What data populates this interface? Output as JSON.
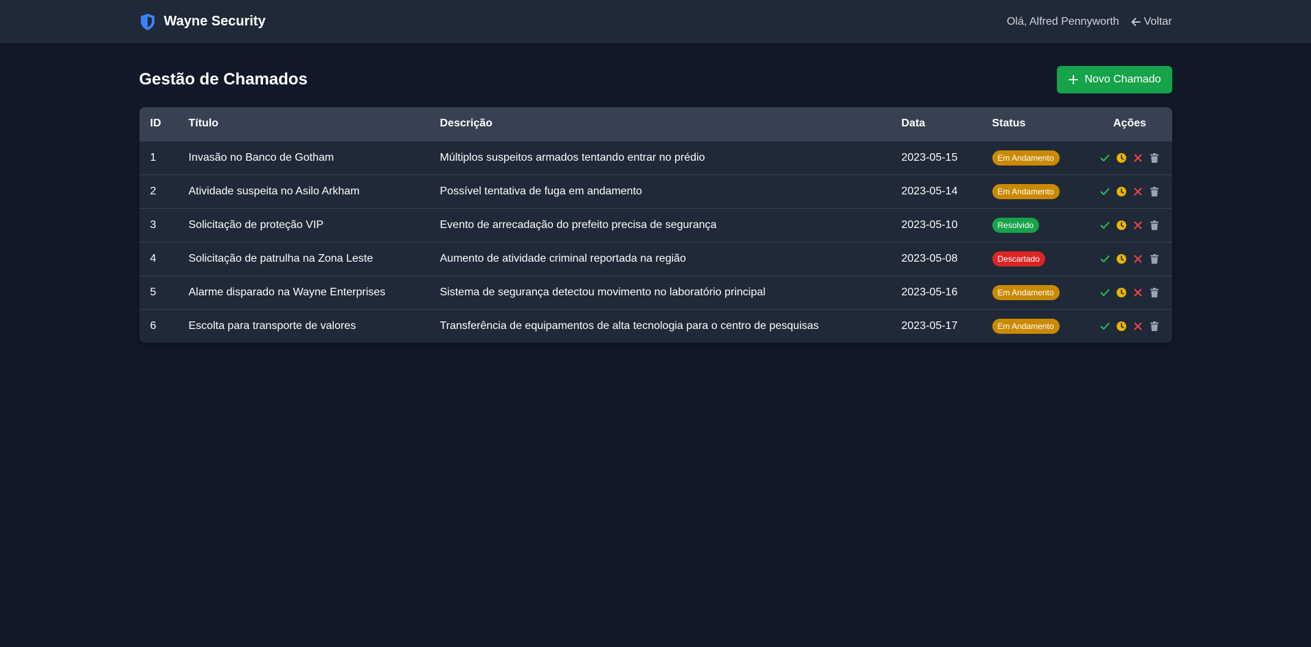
{
  "app": {
    "brand": "Wayne Security",
    "greeting": "Olá, Alfred Pennyworth",
    "back_label": "Voltar"
  },
  "page": {
    "title": "Gestão de Chamados",
    "new_button_label": "Novo Chamado"
  },
  "colors": {
    "background": "#111827",
    "navbar": "#1f2937",
    "table_header": "#374151",
    "brand_icon": "#3b82f6",
    "primary_button": "#16a34a",
    "status_em_andamento": "#ca8a04",
    "status_resolvido": "#16a34a",
    "status_descartado": "#dc2626",
    "action_resolve": "#22c55e",
    "action_pending": "#eab308",
    "action_discard": "#ef4444",
    "action_delete": "#9ca3af"
  },
  "table": {
    "columns": [
      "ID",
      "Título",
      "Descrição",
      "Data",
      "Status",
      "Ações"
    ],
    "rows": [
      {
        "id": "1",
        "title": "Invasão no Banco de Gotham",
        "description": "Múltiplos suspeitos armados tentando entrar no prédio",
        "date": "2023-05-15",
        "status": "Em Andamento",
        "status_color": "#ca8a04"
      },
      {
        "id": "2",
        "title": "Atividade suspeita no Asilo Arkham",
        "description": "Possível tentativa de fuga em andamento",
        "date": "2023-05-14",
        "status": "Em Andamento",
        "status_color": "#ca8a04"
      },
      {
        "id": "3",
        "title": "Solicitação de proteção VIP",
        "description": "Evento de arrecadação do prefeito precisa de segurança",
        "date": "2023-05-10",
        "status": "Resolvido",
        "status_color": "#16a34a"
      },
      {
        "id": "4",
        "title": "Solicitação de patrulha na Zona Leste",
        "description": "Aumento de atividade criminal reportada na região",
        "date": "2023-05-08",
        "status": "Descartado",
        "status_color": "#dc2626"
      },
      {
        "id": "5",
        "title": "Alarme disparado na Wayne Enterprises",
        "description": "Sistema de segurança detectou movimento no laboratório principal",
        "date": "2023-05-16",
        "status": "Em Andamento",
        "status_color": "#ca8a04"
      },
      {
        "id": "6",
        "title": "Escolta para transporte de valores",
        "description": "Transferência de equipamentos de alta tecnologia para o centro de pesquisas",
        "date": "2023-05-17",
        "status": "Em Andamento",
        "status_color": "#ca8a04"
      }
    ]
  }
}
